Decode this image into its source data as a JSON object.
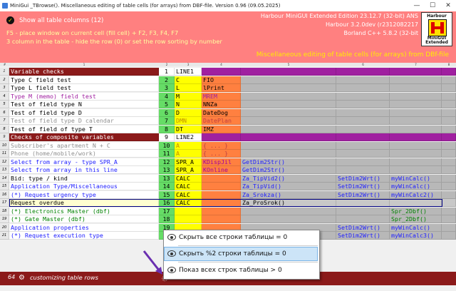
{
  "window": {
    "title": "MiniGui _TBrowse(). Miscellaneous editing of table cells (for arrays) from DBF-file.   Version 0.96 (09.05.2025)",
    "minimize": "—",
    "maximize": "☐",
    "close": "✕"
  },
  "header": {
    "show_all": "Show all table columns (12)",
    "hint1": "F5 - place window on current cell (fill cell) + F2, F3, F4, F7",
    "hint2": "3 column in the table - hide the row (0) or set the row sorting by number",
    "info1": "Harbour MiniGUI Extended Edition 23.12.7 (32-bit) ANS",
    "info2": "Harbour 3.2.0dev (r2312082217",
    "info3": "Borland C++ 5.8.2 (32-bit",
    "banner": "Miscellaneous editing of table cells (for arrays) from DBf-file",
    "logo_top": "Harbour",
    "logo_b1": "MiniGUI",
    "logo_b2": "Extended"
  },
  "columns": [
    "#",
    "1",
    "2",
    "3",
    "4",
    "5",
    "6",
    "7",
    "8",
    ""
  ],
  "rows": [
    {
      "n": "1",
      "c2": "Variable checks",
      "c3": "1",
      "c4": "LINE1",
      "c5": "",
      "c6": "",
      "c7": "",
      "c8": "",
      "kind": "section"
    },
    {
      "n": "2",
      "c2": "    Type C field test",
      "c3": "2",
      "c4": "C",
      "c5": "FIO",
      "c6": "",
      "c7": "",
      "c8": "",
      "kind": "black"
    },
    {
      "n": "3",
      "c2": "    Type L field test",
      "c3": "3",
      "c4": "L",
      "c5": "lPrint",
      "c6": "",
      "c7": "",
      "c8": "",
      "kind": "black"
    },
    {
      "n": "4",
      "c2": "    Type M (memo) field test",
      "c3": "4",
      "c4": "M",
      "c5": "MREM",
      "c6": "",
      "c7": "",
      "c8": "",
      "kind": "purple"
    },
    {
      "n": "5",
      "c2": "    Test of field type N",
      "c3": "5",
      "c4": "N",
      "c5": "NNZa",
      "c6": "",
      "c7": "",
      "c8": "",
      "kind": "black"
    },
    {
      "n": "6",
      "c2": "    Test of field type D",
      "c3": "6",
      "c4": "D",
      "c5": "DateDog",
      "c6": "",
      "c7": "",
      "c8": "",
      "kind": "black"
    },
    {
      "n": "7",
      "c2": "    Test of field type D calendar",
      "c3": "7",
      "c4": "DMN",
      "c5": "DatePlan",
      "c6": "",
      "c7": "",
      "c8": "",
      "kind": "gray"
    },
    {
      "n": "8",
      "c2": "    Test of field of type T",
      "c3": "8",
      "c4": "DT",
      "c5": "IMZ",
      "c6": "",
      "c7": "",
      "c8": "",
      "kind": "black"
    },
    {
      "n": "9",
      "c2": "Checks of composite variables",
      "c3": "9",
      "c4": "LINE2",
      "c5": "",
      "c6": "",
      "c7": "",
      "c8": "",
      "kind": "section"
    },
    {
      "n": "10",
      "c2": "    Subscriber's apartment N + C",
      "c3": "10",
      "c4": "A",
      "c5": "{ ... }",
      "c6": "",
      "c7": "",
      "c8": "",
      "kind": "gray"
    },
    {
      "n": "11",
      "c2": "    Phone (home/mobile/work)",
      "c3": "11",
      "c4": "A",
      "c5": "{ ... }",
      "c6": "",
      "c7": "",
      "c8": "",
      "kind": "gray"
    },
    {
      "n": "12",
      "c2": "    Select from array - type SPR_A",
      "c3": "12",
      "c4": "SPR_A",
      "c5": "KDispJil",
      "c6": "GetDim2Str()",
      "c7": "",
      "c8": "",
      "kind": "blue"
    },
    {
      "n": "13",
      "c2": "    Select from array in this line",
      "c3": "13",
      "c4": "SPR_A",
      "c5": "KOnline",
      "c6": "GetDim2Str()",
      "c7": "",
      "c8": "",
      "kind": "blue"
    },
    {
      "n": "14",
      "c2": "    Bid: type / kind",
      "c3": "13",
      "c4": "CALC",
      "c5": "",
      "c6": "Za_TipVid2()",
      "c7": "SetDim2Wrt()",
      "c8": "myWinCalc()",
      "kind": "black"
    },
    {
      "n": "15",
      "c2": "    Application Type/Miscellaneous",
      "c3": "14",
      "c4": "CALC",
      "c5": "",
      "c6": "Za_TipVid()",
      "c7": "SetDim2Wrt()",
      "c8": "myWinCalc()",
      "kind": "blue"
    },
    {
      "n": "16",
      "c2": "    (*) Request urgency type",
      "c3": "15",
      "c4": "CALC",
      "c5": "",
      "c6": "Za_Srokza()",
      "c7": "SetDim2Wrt()",
      "c8": "myWinCalc2()",
      "kind": "blue"
    },
    {
      "n": "17",
      "c2": "    Request overdue",
      "c3": "16",
      "c4": "CALC",
      "c5": "",
      "c6": "Za_ProSrok()",
      "c7": "",
      "c8": "",
      "kind": "selected"
    },
    {
      "n": "18",
      "c2": "    (*) Electronics Master (dbf)",
      "c3": "17",
      "c4": "",
      "c5": "",
      "c6": "",
      "c7": "",
      "c8": "Spr_2Dbf()",
      "kind": "green"
    },
    {
      "n": "19",
      "c2": "    (*) Gate Master (dbf)",
      "c3": "18",
      "c4": "",
      "c5": "",
      "c6": "",
      "c7": "",
      "c8": "Spr_2Dbf()",
      "kind": "green"
    },
    {
      "n": "20",
      "c2": "    Application properties",
      "c3": "19",
      "c4": "",
      "c5": "",
      "c6": "",
      "c7": "SetDim2Wrt()",
      "c8": "myWinCalc()",
      "kind": "blue"
    },
    {
      "n": "21",
      "c2": "    (*) Request execution type",
      "c3": "20",
      "c4": "",
      "c5": "",
      "c6": "",
      "c7": "SetDim2Wrt()",
      "c8": "myWinCalc3()",
      "kind": "blue"
    }
  ],
  "colors": {
    "header_bg": "#ff8080",
    "section_bg": "#8b1a1a",
    "selected_bg": "#ffffd0",
    "col3_bg": "#66dd66",
    "col4_bg": "#ffff00",
    "col5_bg": "#ff8040",
    "grid_bg": "#b8b8b8",
    "blue_text": "#2020ff",
    "green_text": "#008000",
    "purple_text": "#a020a0",
    "gray_text": "#909090"
  },
  "footer": {
    "count": "64",
    "text": "customizing table rows",
    "icon": "gear-icon"
  },
  "popup": {
    "items": [
      "Скрыть все строки таблицы = 0",
      "Скрыть %2  строки таблицы = 0",
      "Показ всех строк таблицы > 0"
    ],
    "icon": "eye-icon"
  }
}
